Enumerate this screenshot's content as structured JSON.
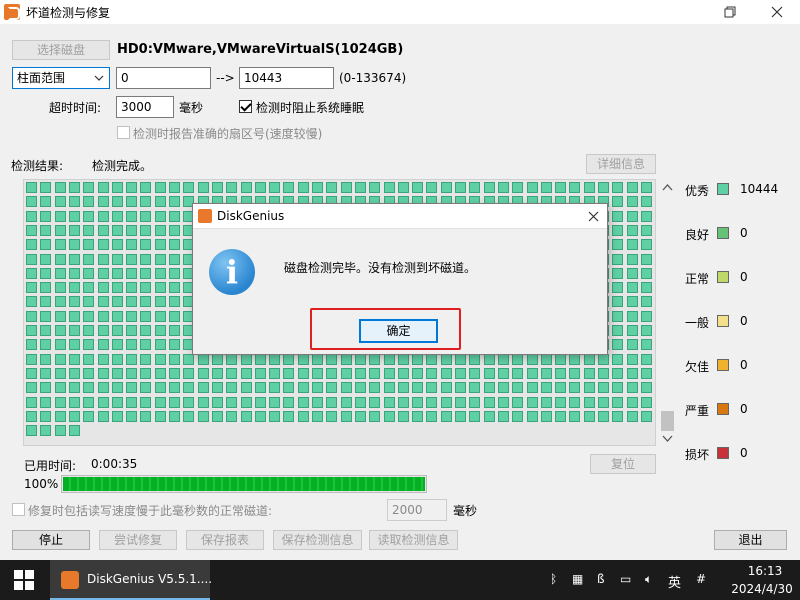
{
  "window": {
    "title": "坏道检测与修复",
    "maximize_icon": "restore-icon",
    "close_icon": "close-icon"
  },
  "toolbar": {
    "select_disk_label": "选择磁盘",
    "disk_info": "HD0:VMware,VMwareVirtualS(1024GB)"
  },
  "range": {
    "mode_value": "柱面范围",
    "start_value": "0",
    "arrow": "-->",
    "end_value": "10443",
    "range_hint": "(0-133674)"
  },
  "timeout": {
    "label": "超时时间:",
    "value": "3000",
    "unit": "毫秒",
    "prevent_sleep_label": "检测时阻止系统睡眠",
    "prevent_sleep_checked": true,
    "report_sector_label": "检测时报告准确的扇区号(速度较慢)",
    "report_sector_checked": false
  },
  "result": {
    "label": "检测结果:",
    "value": "检测完成。",
    "details_button": "详细信息"
  },
  "legend": [
    {
      "label": "优秀",
      "color": "#5fd0a4",
      "count": "10444"
    },
    {
      "label": "良好",
      "color": "#66c276",
      "count": "0"
    },
    {
      "label": "正常",
      "color": "#bfd86a",
      "count": "0"
    },
    {
      "label": "一般",
      "color": "#f4e08a",
      "count": "0"
    },
    {
      "label": "欠佳",
      "color": "#f0b22c",
      "count": "0"
    },
    {
      "label": "严重",
      "color": "#d9780e",
      "count": "0"
    },
    {
      "label": "损坏",
      "color": "#c8323a",
      "count": "0"
    }
  ],
  "status": {
    "elapsed_label": "已用时间:",
    "elapsed_value": "0:00:35",
    "reset_button": "复位",
    "progress_text": "100%",
    "progress_value": 100
  },
  "repair_option": {
    "label": "修复时包括读写速度慢于此毫秒数的正常磁道:",
    "checked": false,
    "value": "2000",
    "unit": "毫秒"
  },
  "bottom_buttons": {
    "stop": "停止",
    "try_repair": "尝试修复",
    "save_report": "保存报表",
    "save_info": "保存检测信息",
    "read_info": "读取检测信息",
    "exit": "退出"
  },
  "dialog": {
    "title": "DiskGenius",
    "icon": "info-icon",
    "message": "磁盘检测完毕。没有检测到坏磁道。",
    "ok_label": "确定",
    "close_icon": "close-icon"
  },
  "taskbar": {
    "app_label": "DiskGenius V5.5.1....",
    "tray_lang": "英",
    "clock_time": "16:13",
    "clock_date": "2024/4/30"
  }
}
